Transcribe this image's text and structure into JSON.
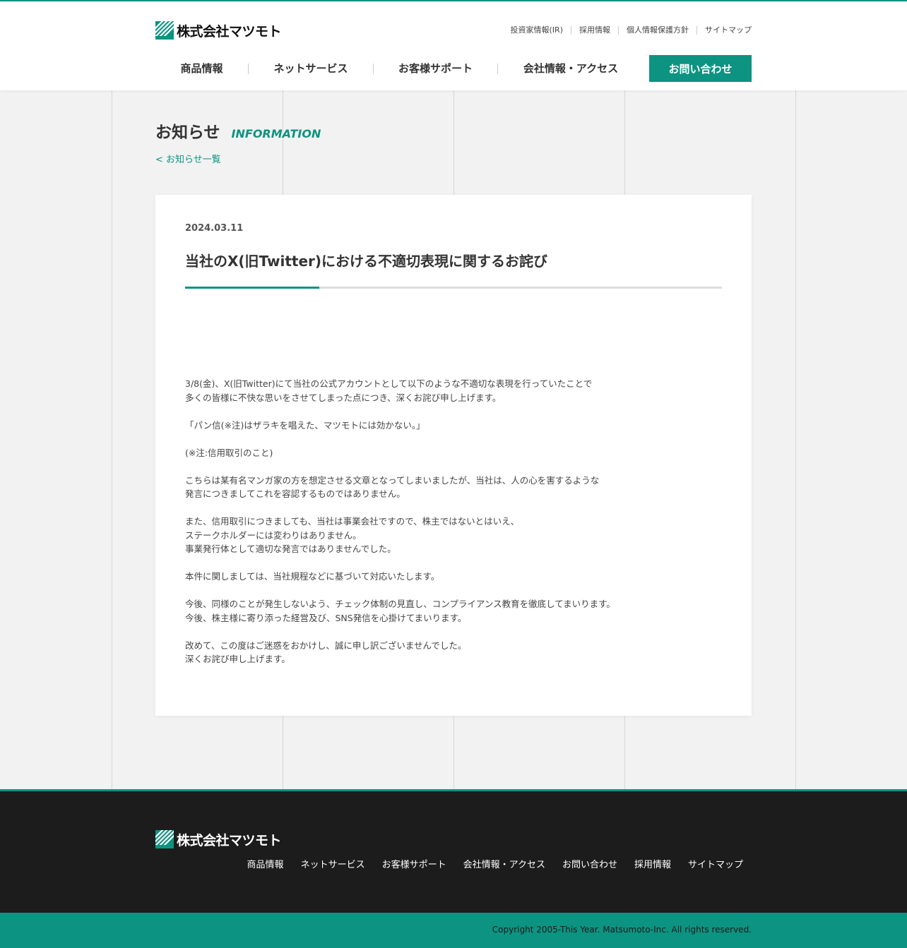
{
  "brand": {
    "company_name": "株式会社マツモト",
    "accent_color": "#0d9381"
  },
  "utility_nav": [
    "投資家情報(IR)",
    "採用情報",
    "個人情報保護方針",
    "サイトマップ"
  ],
  "main_nav": [
    "商品情報",
    "ネットサービス",
    "お客様サポート",
    "会社情報・アクセス"
  ],
  "contact_label": "お問い合わせ",
  "page": {
    "title": "お知らせ",
    "subtitle": "INFORMATION",
    "back_link": "< お知らせ一覧"
  },
  "post": {
    "date": "2024.03.11",
    "title": "当社のX(旧Twitter)における不適切表現に関するお詫び",
    "paragraphs": [
      [
        "3/8(金)、X(旧Twitter)にて当社の公式アカウントとして以下のような不適切な表現を行っていたことで",
        "多くの皆様に不快な思いをさせてしまった点につき、深くお詫び申し上げます。"
      ],
      [
        "「パン信(※注)はザラキを唱えた、マツモトには効かない。」"
      ],
      [
        "(※注:信用取引のこと)"
      ],
      [
        "こちらは某有名マンガ家の方を想定させる文章となってしまいましたが、当社は、人の心を害するような",
        "発言につきましてこれを容認するものではありません。"
      ],
      [
        "また、信用取引につきましても、当社は事業会社ですので、株主ではないとはいえ、",
        "ステークホルダーには変わりはありません。",
        "事業発行体として適切な発言ではありませんでした。"
      ],
      [
        "本件に関しましては、当社規程などに基づいて対応いたします。"
      ],
      [
        "今後、同様のことが発生しないよう、チェック体制の見直し、コンプライアンス教育を徹底してまいります。",
        "今後、株主様に寄り添った経営及び、SNS発信を心掛けてまいります。"
      ],
      [
        "改めて、この度はご迷惑をおかけし、誠に申し訳ございませんでした。",
        "深くお詫び申し上げます。"
      ]
    ]
  },
  "footer_nav": [
    "商品情報",
    "ネットサービス",
    "お客様サポート",
    "会社情報・アクセス",
    "お問い合わせ",
    "採用情報",
    "サイトマップ"
  ],
  "copyright": "Copyright 2005-This Year. Matsumoto-Inc. All rights reserved."
}
